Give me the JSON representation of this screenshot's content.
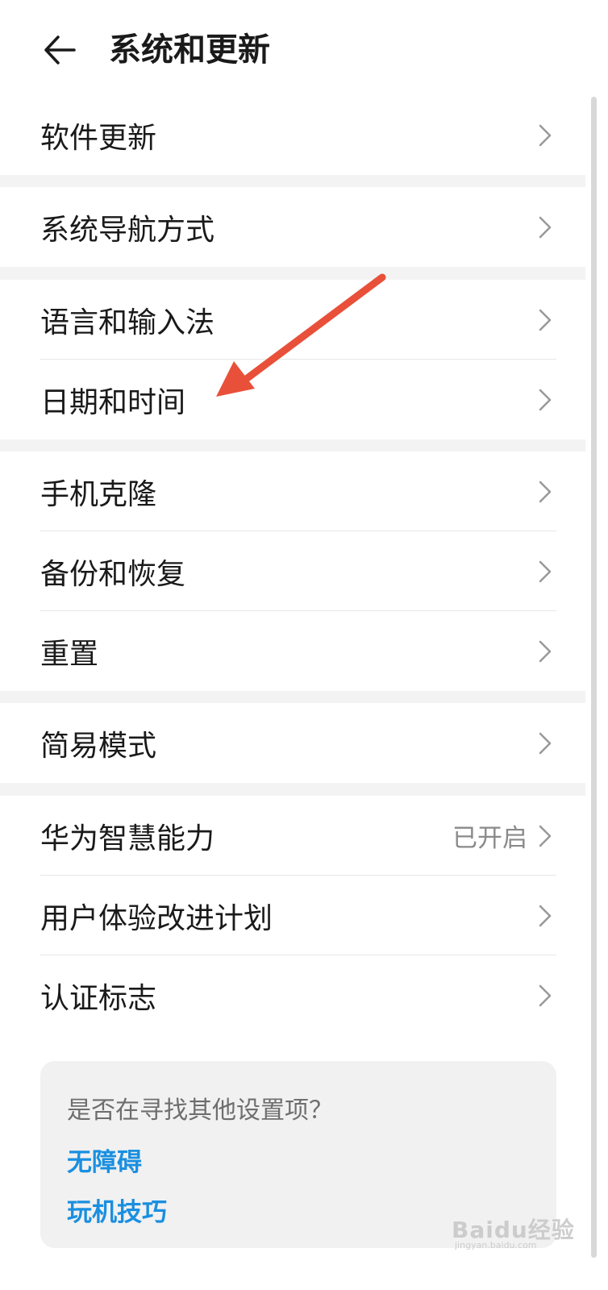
{
  "header": {
    "title": "系统和更新"
  },
  "groups": [
    {
      "items": [
        {
          "label": "软件更新"
        }
      ]
    },
    {
      "items": [
        {
          "label": "系统导航方式"
        }
      ]
    },
    {
      "items": [
        {
          "label": "语言和输入法"
        },
        {
          "label": "日期和时间"
        }
      ]
    },
    {
      "items": [
        {
          "label": "手机克隆"
        },
        {
          "label": "备份和恢复"
        },
        {
          "label": "重置"
        }
      ]
    },
    {
      "items": [
        {
          "label": "简易模式"
        }
      ]
    },
    {
      "items": [
        {
          "label": "华为智慧能力",
          "value": "已开启"
        },
        {
          "label": "用户体验改进计划"
        },
        {
          "label": "认证标志"
        }
      ]
    }
  ],
  "help": {
    "title": "是否在寻找其他设置项？",
    "links": [
      {
        "label": "无障碍"
      },
      {
        "label": "玩机技巧"
      }
    ]
  },
  "watermark": {
    "text": "Baidu经验",
    "sub": "jingyan.baidu.com"
  },
  "colors": {
    "accent": "#1a8fe0",
    "annotation": "#e8503a",
    "separator": "#f3f3f3"
  },
  "icons": {
    "back": "arrow-left-icon",
    "row": "chevron-right-icon"
  }
}
